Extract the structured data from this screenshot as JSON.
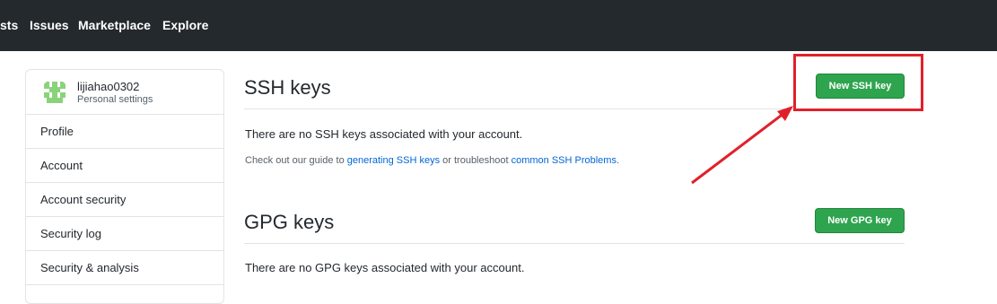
{
  "topnav": {
    "items": [
      "sts",
      "Issues",
      "Marketplace",
      "Explore"
    ]
  },
  "sidebar": {
    "username": "lijiahao0302",
    "subtitle": "Personal settings",
    "items": [
      {
        "label": "Profile"
      },
      {
        "label": "Account"
      },
      {
        "label": "Account security"
      },
      {
        "label": "Security log"
      },
      {
        "label": "Security & analysis"
      }
    ]
  },
  "ssh": {
    "title": "SSH keys",
    "button": "New SSH key",
    "empty_text": "There are no SSH keys associated with your account.",
    "guide_prefix": "Check out our guide to ",
    "guide_link1": "generating SSH keys",
    "guide_middle": " or troubleshoot ",
    "guide_link2": "common SSH Problems",
    "guide_suffix": "."
  },
  "gpg": {
    "title": "GPG keys",
    "button": "New GPG key",
    "empty_text": "There are no GPG keys associated with your account."
  },
  "colors": {
    "topbar": "#24292e",
    "button_green": "#2ea44f",
    "link": "#0366d6",
    "annotation": "#e0212b"
  },
  "icons": {
    "avatar": "identicon-avatar",
    "annotation": "red-highlight-box-and-arrow"
  }
}
